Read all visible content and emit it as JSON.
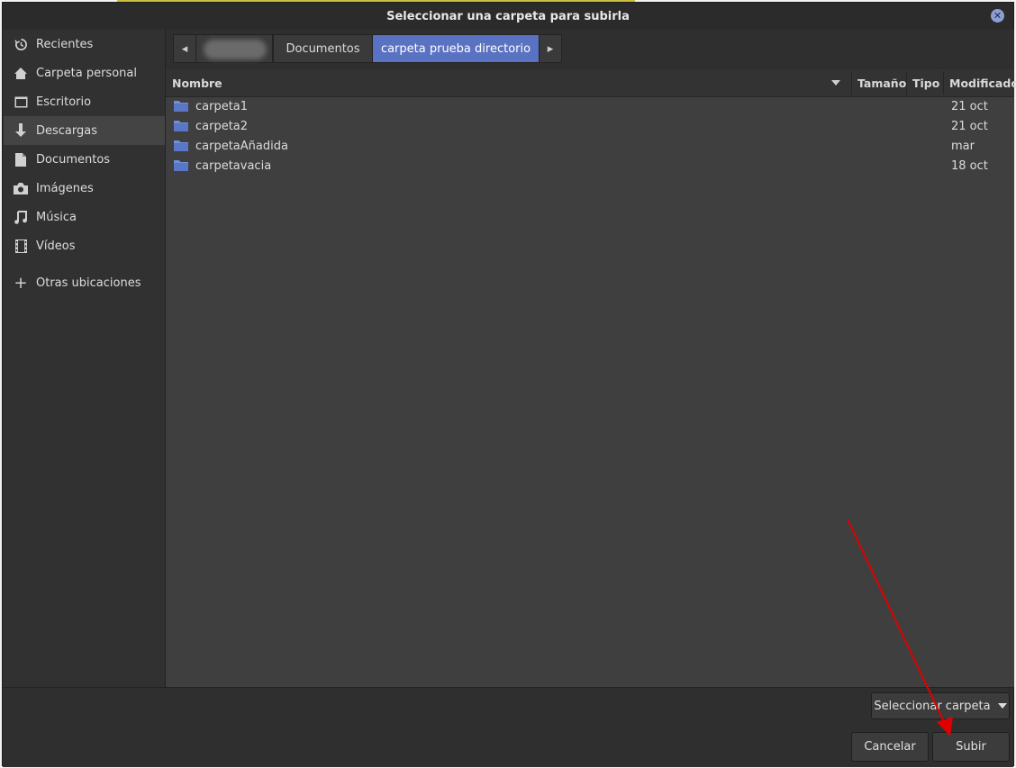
{
  "dialog": {
    "title": "Seleccionar una carpeta para subirla"
  },
  "sidebar": {
    "items": [
      {
        "label": "Recientes",
        "icon": "history-icon"
      },
      {
        "label": "Carpeta personal",
        "icon": "home-icon"
      },
      {
        "label": "Escritorio",
        "icon": "desktop-icon"
      },
      {
        "label": "Descargas",
        "icon": "download-icon",
        "active": true
      },
      {
        "label": "Documentos",
        "icon": "document-icon"
      },
      {
        "label": "Imágenes",
        "icon": "camera-icon"
      },
      {
        "label": "Música",
        "icon": "music-icon"
      },
      {
        "label": "Vídeos",
        "icon": "film-icon"
      },
      {
        "label": "Otras ubicaciones",
        "icon": "plus-icon"
      }
    ]
  },
  "pathbar": {
    "crumbs": [
      "Documentos",
      "carpeta prueba directorio"
    ],
    "active_index": 1
  },
  "columns": {
    "name": "Nombre",
    "size": "Tamaño",
    "type": "Tipo",
    "modified": "Modificado"
  },
  "files": [
    {
      "name": "carpeta1",
      "modified": "21 oct"
    },
    {
      "name": "carpeta2",
      "modified": "21 oct"
    },
    {
      "name": "carpetaAñadida",
      "modified": "mar"
    },
    {
      "name": "carpetavacia",
      "modified": "18 oct"
    }
  ],
  "footer": {
    "filter_select": "Seleccionar carpeta",
    "cancel_label": "Cancelar",
    "submit_label": "Subir"
  },
  "colors": {
    "accent": "#5a72c2",
    "folder": "#6f8fd8",
    "annotation_arrow": "#e00000"
  }
}
